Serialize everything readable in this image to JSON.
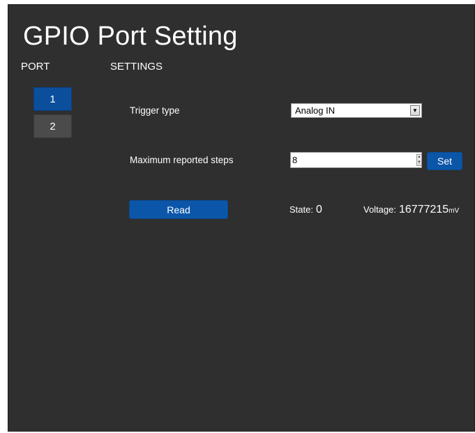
{
  "page": {
    "title": "GPIO Port Setting",
    "port_header": "PORT",
    "settings_header": "SETTINGS"
  },
  "ports": [
    {
      "label": "1",
      "selected": true
    },
    {
      "label": "2",
      "selected": false
    }
  ],
  "settings": {
    "trigger_type_label": "Trigger type",
    "trigger_type_value": "Analog IN",
    "max_steps_label": "Maximum reported steps",
    "max_steps_value": "8",
    "set_label": "Set",
    "read_label": "Read",
    "state_label": "State:",
    "state_value": "0",
    "voltage_label": "Voltage:",
    "voltage_value": "16777215",
    "voltage_unit": "mV"
  },
  "icons": {
    "dropdown": "chevron-down-icon",
    "spinner_up": "caret-up-icon",
    "spinner_down": "caret-down-icon"
  },
  "colors": {
    "background": "#2f2f2f",
    "accent": "#0b56a8",
    "inactive_port": "#4b4b4b"
  }
}
